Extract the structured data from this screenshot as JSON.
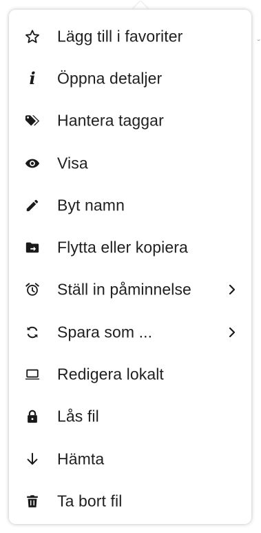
{
  "menu": {
    "items": [
      {
        "label": "Lägg till i favoriter",
        "icon": "star-outline-icon"
      },
      {
        "label": "Öppna detaljer",
        "icon": "info-icon"
      },
      {
        "label": "Hantera taggar",
        "icon": "tags-icon"
      },
      {
        "label": "Visa",
        "icon": "eye-icon"
      },
      {
        "label": "Byt namn",
        "icon": "pencil-icon"
      },
      {
        "label": "Flytta eller kopiera",
        "icon": "folder-move-icon"
      },
      {
        "label": "Ställ in påminnelse",
        "icon": "alarm-clock-icon",
        "submenu": true
      },
      {
        "label": "Spara som ...",
        "icon": "sync-arrows-icon",
        "submenu": true
      },
      {
        "label": "Redigera lokalt",
        "icon": "laptop-icon"
      },
      {
        "label": "Lås fil",
        "icon": "lock-icon"
      },
      {
        "label": "Hämta",
        "icon": "arrow-down-icon"
      },
      {
        "label": "Ta bort fil",
        "icon": "trash-icon"
      }
    ]
  },
  "colors": {
    "text": "#1f1f1f",
    "icon": "#1a1a1a",
    "background": "#ffffff"
  }
}
